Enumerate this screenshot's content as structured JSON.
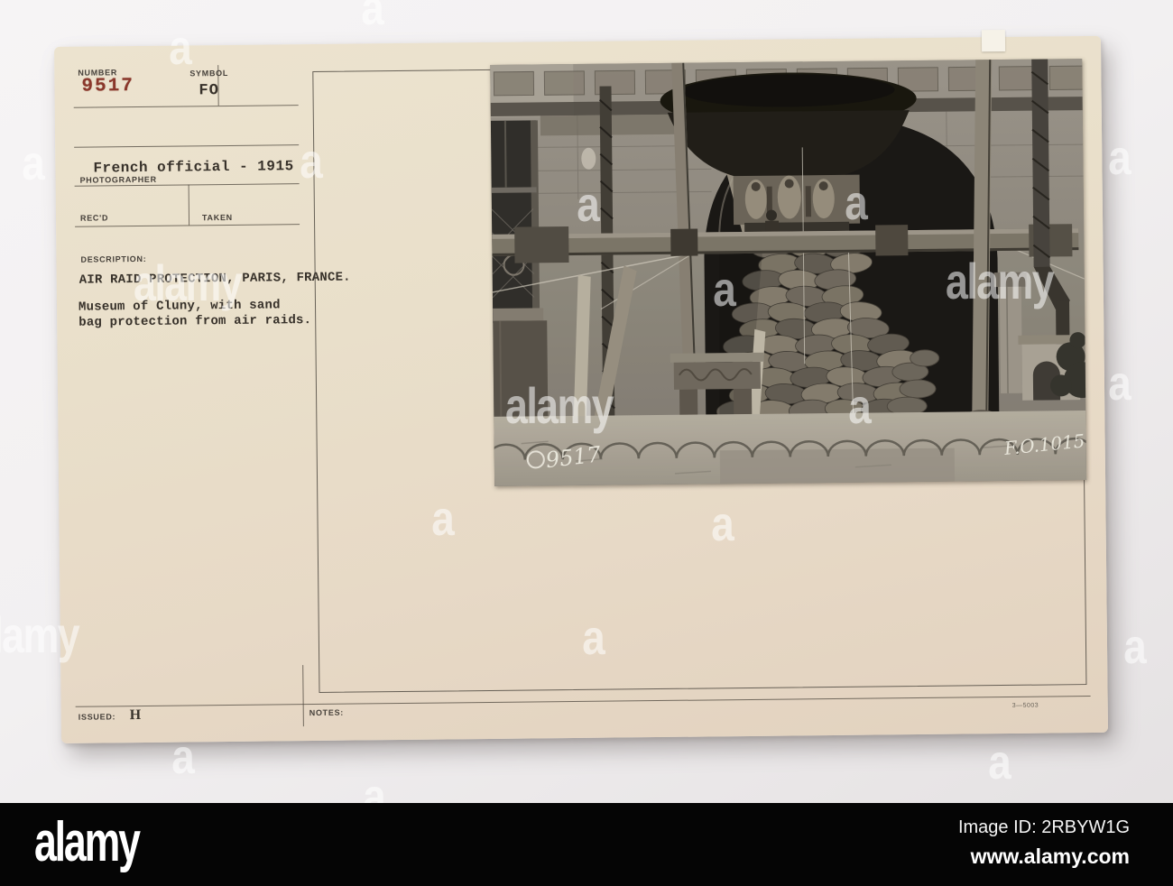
{
  "card": {
    "number_label": "NUMBER",
    "number_value": "9517",
    "symbol_label": "SYMBOL",
    "symbol_value": "FO",
    "photographer_value": "French official - 1915",
    "photographer_label": "PHOTOGRAPHER",
    "recd_label": "REC'D",
    "taken_label": "TAKEN",
    "description_label": "DESCRIPTION:",
    "description_lines": [
      "AIR RAID PROTECTION, PARIS, FRANCE.",
      "Museum of Cluny, with sand",
      "bag protection from air raids."
    ],
    "issued_label": "ISSUED:",
    "issued_value": "H",
    "notes_label": "NOTES:",
    "print_code": "3—5003",
    "photo_caption_left": "9517",
    "photo_caption_right": "F.O.1015"
  },
  "watermark": {
    "letter": "a",
    "word": "alamy"
  },
  "footer": {
    "logo": "alamy",
    "image_id": "Image ID: 2RBYW1G",
    "url": "www.alamy.com"
  },
  "colors": {
    "card": "#e9dfca",
    "accent_red": "#8a372b",
    "bar": "#050505"
  }
}
